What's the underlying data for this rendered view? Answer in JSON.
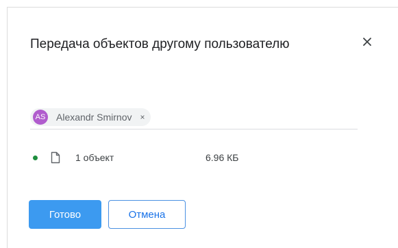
{
  "dialog": {
    "title": "Передача объектов другому пользователю",
    "close_icon": "close-icon"
  },
  "recipient": {
    "initials": "AS",
    "name": "Alexandr Smirnov",
    "remove_glyph": "×",
    "avatar_color": "#b05ccd"
  },
  "item": {
    "status_color": "#1e8e3e",
    "icon": "file-icon",
    "count_label": "1 объект",
    "size": "6.96 КБ"
  },
  "actions": {
    "done_label": "Готово",
    "cancel_label": "Отмена",
    "accent": "#3c9af0"
  }
}
